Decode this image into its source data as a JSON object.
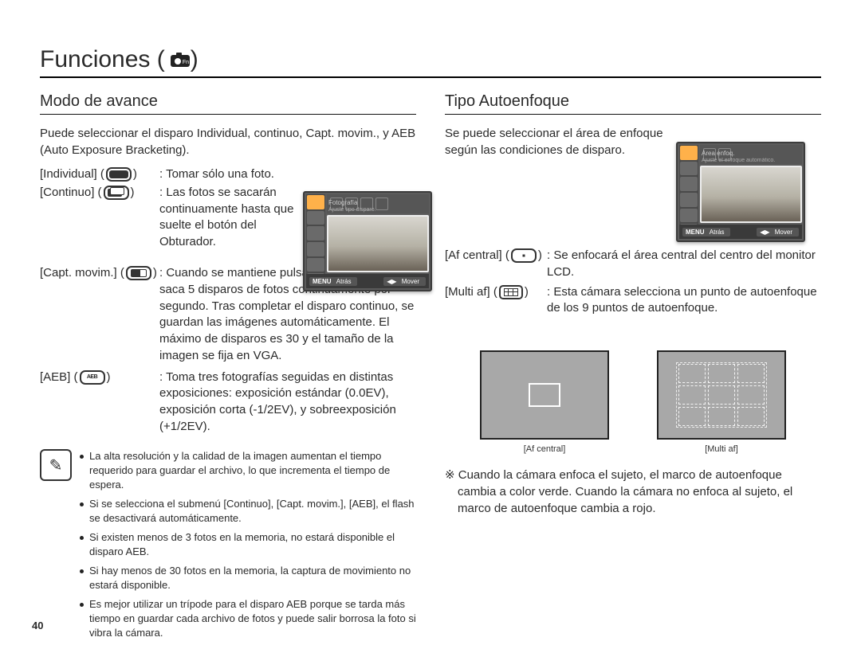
{
  "page_number": "40",
  "title": "Funciones (",
  "title_close": " )",
  "left": {
    "heading": "Modo de avance",
    "intro": "Puede seleccionar el disparo Individual, continuo, Capt. movim., y AEB (Auto Exposure Bracketing).",
    "items": [
      {
        "label": "[Individual] (",
        "label2": ") ",
        "desc": ": Tomar sólo una foto."
      },
      {
        "label": "[Continuo] (",
        "label2": ") ",
        "desc": ": Las fotos se sacarán continuamente hasta que suelte el botón del Obturador."
      },
      {
        "label": "[Capt. movim.] (",
        "label2": ") ",
        "desc": ": Cuando se mantiene pulsado el obturador, saca 5 disparos de fotos continuamente por segundo. Tras completar el disparo continuo, se guardan las imágenes automáticamente. El máximo de disparos es 30 y el tamaño de la imagen se fija en VGA."
      },
      {
        "label": "[AEB] (",
        "label2": ") ",
        "desc": ": Toma tres fotografías seguidas en distintas exposiciones: exposición estándar (0.0EV), exposición corta (-1/2EV), y sobreexposición (+1/2EV)."
      }
    ],
    "notes": [
      "La alta resolución y la calidad de la imagen aumentan el tiempo requerido para guardar el archivo, lo que incrementa el tiempo de espera.",
      "Si se selecciona el submenú [Continuo], [Capt. movim.], [AEB], el flash se desactivará automáticamente.",
      "Si existen menos de 3 fotos en la memoria, no estará disponible el disparo AEB.",
      "Si hay menos de 30 fotos en la memoria, la captura de movimiento no estará disponible.",
      "Es mejor utilizar un trípode para el disparo AEB porque se tarda más tiempo en guardar cada archivo de fotos y puede salir borrosa la foto si vibra la cámara."
    ]
  },
  "right": {
    "heading": "Tipo Autoenfoque",
    "intro": "Se puede seleccionar el área de enfoque según las condiciones de disparo.",
    "items": [
      {
        "label": "[Af central] (",
        "label2": ") ",
        "desc": ": Se enfocará el área central del centro del monitor LCD."
      },
      {
        "label": "[Multi af] (",
        "label2": ") ",
        "desc": ": Esta cámara selecciona un punto de autoenfoque de los 9 puntos de autoenfoque."
      }
    ],
    "fig_center": "[Af central]",
    "fig_multi": "[Multi af]",
    "asterisk": "※ Cuando la cámara enfoca el sujeto, el marco de autoenfoque cambia a color verde. Cuando la cámara no enfoca al sujeto, el marco de autoenfoque cambia a rojo."
  },
  "shot_left": {
    "line1": "Fotografía",
    "line2": "Ajuste tipo disparo.",
    "back": "Atrás",
    "move": "Mover"
  },
  "shot_right": {
    "line1": "Área enfoq.",
    "line2": "Ajuste el enfoque automático.",
    "back": "Atrás",
    "move": "Mover"
  }
}
